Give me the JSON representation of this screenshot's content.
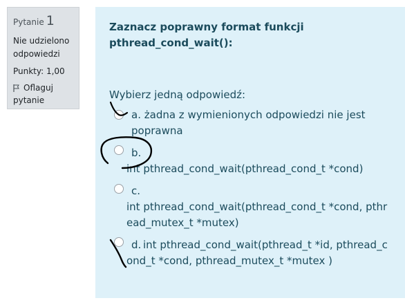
{
  "question": {
    "number_label": "Pytanie",
    "number": "1",
    "state": "Nie udzielono odpowiedzi",
    "grade": "Punkty: 1,00",
    "flag_label": "Oflaguj",
    "flag_label_2": "pytanie",
    "text": "Zaznacz poprawny format funkcji pthread_cond_wait():",
    "prompt": "Wybierz jedną odpowiedź:",
    "options": [
      {
        "letter": "a.",
        "text": "żadna z wymienionych odpowiedzi nie jest poprawna"
      },
      {
        "letter": "b.",
        "text": "int pthread_cond_wait(pthread_cond_t *cond)"
      },
      {
        "letter": "c.",
        "text": "int pthread_cond_wait(pthread_cond_t *cond, pthread_mutex_t *mutex)"
      },
      {
        "letter": "d.",
        "text": "int pthread_cond_wait(pthread_t *id, pthread_cond_t *cond, pthread_mutex_t *mutex )"
      }
    ]
  },
  "icons": {
    "flag": "flag-icon",
    "radio": "radio-icon"
  },
  "colors": {
    "info_bg": "#dee2e6",
    "content_bg": "#def1f9",
    "text": "#1b4b5c",
    "ink": "#000000"
  }
}
